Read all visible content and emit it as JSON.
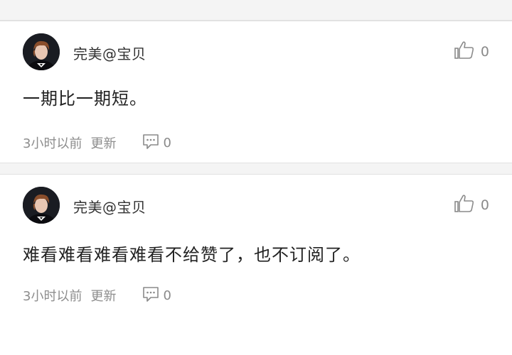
{
  "comments": [
    {
      "username": "完美@宝贝",
      "text": "一期比一期短。",
      "timestamp": "3小时以前",
      "update_label": "更新",
      "likes": "0",
      "replies": "0",
      "icons": {
        "like": "thumbs-up-icon",
        "reply": "comment-bubble-icon"
      }
    },
    {
      "username": "完美@宝贝",
      "text": "难看难看难看难看不给赞了，也不订阅了。",
      "timestamp": "3小时以前",
      "update_label": "更新",
      "likes": "0",
      "replies": "0",
      "icons": {
        "like": "thumbs-up-icon",
        "reply": "comment-bubble-icon"
      }
    }
  ],
  "colors": {
    "background": "#f4f4f4",
    "card": "#ffffff",
    "meta_text": "#8d8d8d",
    "body_text": "#222222"
  }
}
